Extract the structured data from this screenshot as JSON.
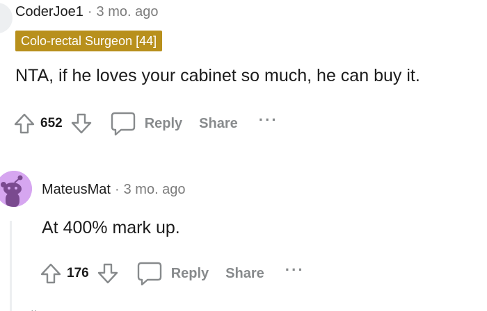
{
  "comments": [
    {
      "username": "CoderJoe1",
      "separator": "·",
      "time": "3 mo. ago",
      "flair": "Colo-rectal Surgeon [44]",
      "body": "NTA, if he loves your cabinet so much, he can buy it.",
      "score": "652",
      "reply_label": "Reply",
      "share_label": "Share",
      "more_label": "···"
    },
    {
      "username": "MateusMat",
      "separator": "·",
      "time": "3 mo. ago",
      "body": "At 400% mark up.",
      "score": "176",
      "reply_label": "Reply",
      "share_label": "Share",
      "more_label": "···"
    }
  ],
  "icons": {
    "upvote": "upvote-icon",
    "downvote": "downvote-icon",
    "reply": "speech-bubble-icon",
    "avatar": "snoo-avatar-icon"
  },
  "colors": {
    "flair_bg": "#b8901c",
    "flair_text": "#ffffff",
    "muted": "#878a8c",
    "avatar_bg": "#d6a6f0",
    "thread_line": "#edeff1"
  }
}
